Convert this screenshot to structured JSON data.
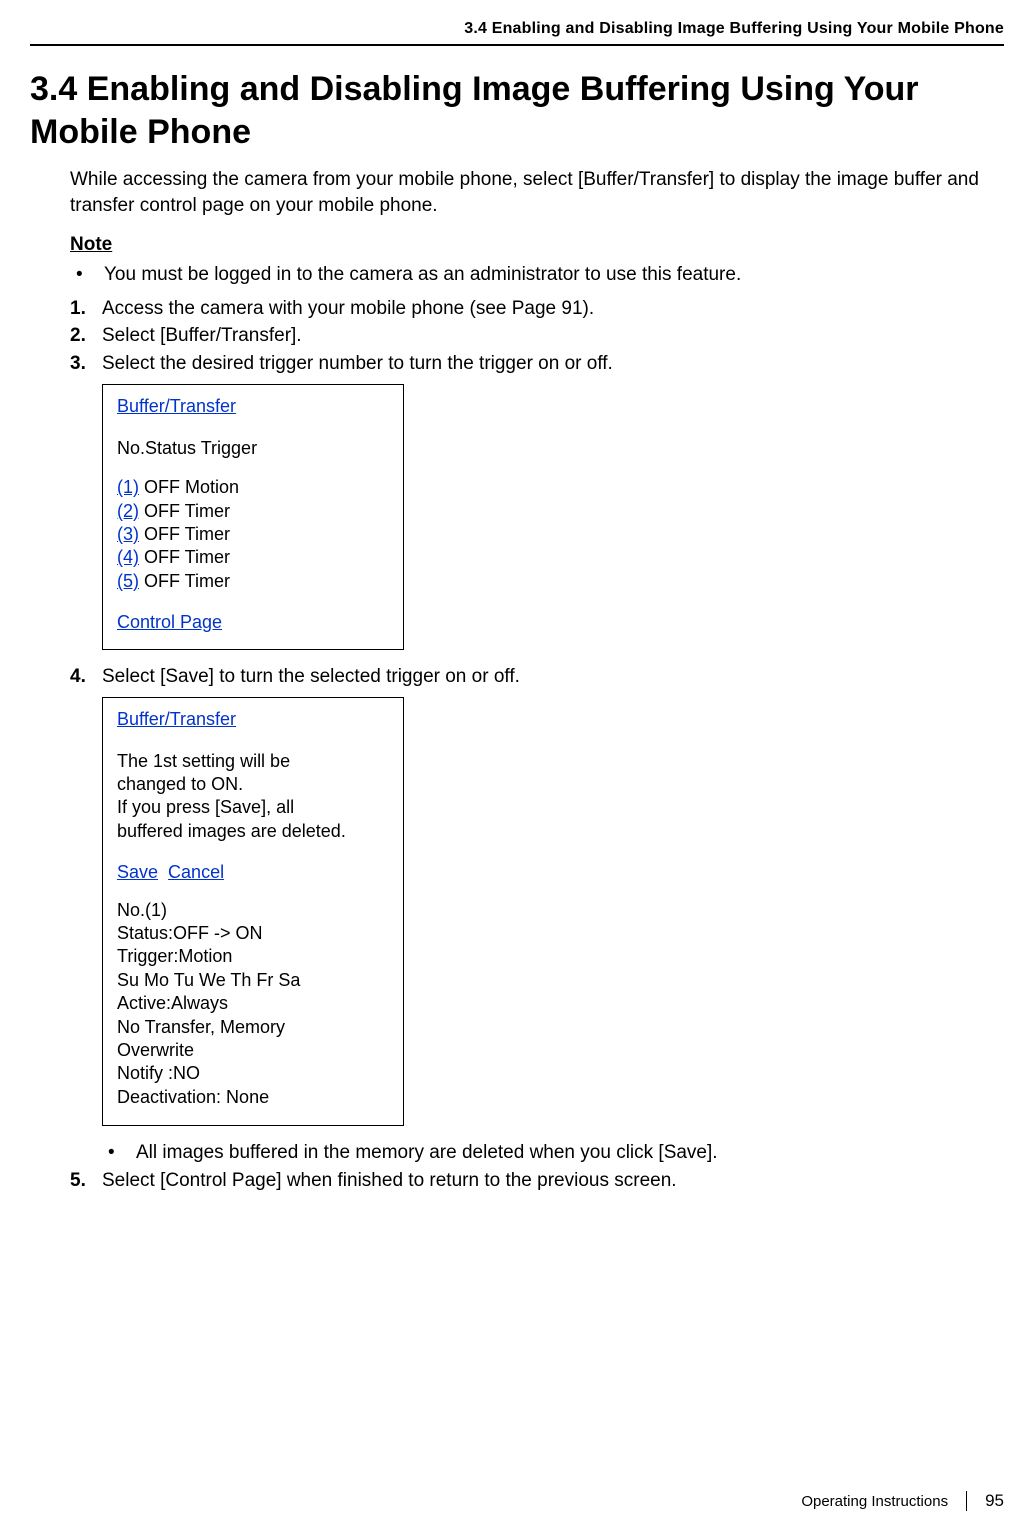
{
  "header": {
    "running_title": "3.4 Enabling and Disabling Image Buffering Using Your Mobile Phone"
  },
  "title": "3.4  Enabling and Disabling Image Buffering Using Your Mobile Phone",
  "intro": "While accessing the camera from your mobile phone, select [Buffer/Transfer] to display the image buffer and transfer control page on your mobile phone.",
  "note": {
    "heading": "Note",
    "items": [
      "You must be logged in to the camera as an administrator to use this feature."
    ]
  },
  "steps": {
    "s1": "Access the camera with your mobile phone (see Page 91).",
    "s2": "Select [Buffer/Transfer].",
    "s3": "Select the desired trigger number to turn the trigger on or off.",
    "s4": "Select [Save] to turn the selected trigger on or off.",
    "s4_bullet": "All images buffered in the memory are deleted when you click [Save].",
    "s5": "Select [Control Page] when finished to return to the previous screen."
  },
  "screenshot1": {
    "title": "Buffer/Transfer",
    "header": "No.Status Trigger",
    "rows": [
      {
        "num": "(1)",
        "rest": " OFF Motion"
      },
      {
        "num": "(2)",
        "rest": " OFF Timer"
      },
      {
        "num": "(3)",
        "rest": " OFF Timer"
      },
      {
        "num": "(4)",
        "rest": " OFF Timer"
      },
      {
        "num": "(5)",
        "rest": " OFF Timer"
      }
    ],
    "footer_link": "Control Page"
  },
  "screenshot2": {
    "title": "Buffer/Transfer",
    "msg1": "The 1st setting will be",
    "msg2": "changed to ON.",
    "msg3": "If you press [Save], all",
    "msg4": "buffered images are deleted.",
    "save": "Save",
    "cancel": "Cancel",
    "l1": "No.(1)",
    "l2": "Status:OFF -> ON",
    "l3": "Trigger:Motion",
    "l4": "Su Mo Tu We Th Fr Sa",
    "l5": "Active:Always",
    "l6": "No Transfer, Memory",
    "l7": "Overwrite",
    "l8": "Notify  :NO",
    "l9": "Deactivation: None"
  },
  "footer": {
    "doc": "Operating Instructions",
    "page": "95"
  }
}
